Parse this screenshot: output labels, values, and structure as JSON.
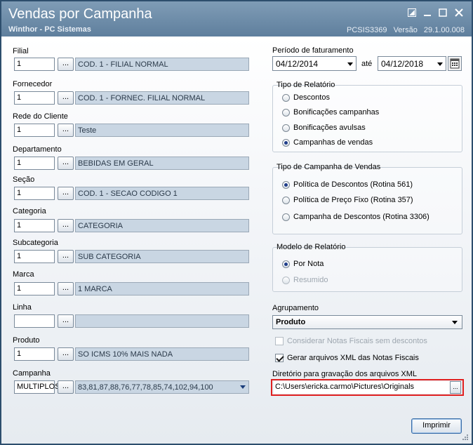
{
  "window": {
    "title": "Vendas por Campanha",
    "subtitle": "Winthor - PC Sistemas",
    "program": "PCSIS3369",
    "version_label": "Versão",
    "version": "29.1.00.008"
  },
  "fields": [
    {
      "label": "Filial",
      "code": "1",
      "desc": "COD. 1 - FILIAL NORMAL"
    },
    {
      "label": "Fornecedor",
      "code": "1",
      "desc": "COD. 1 - FORNEC. FILIAL NORMAL"
    },
    {
      "label": "Rede do Cliente",
      "code": "1",
      "desc": "Teste"
    },
    {
      "label": "Departamento",
      "code": "1",
      "desc": "BEBIDAS EM GERAL"
    },
    {
      "label": "Seção",
      "code": "1",
      "desc": "COD. 1 - SECAO CODIGO 1"
    },
    {
      "label": "Categoria",
      "code": "1",
      "desc": "CATEGORIA"
    },
    {
      "label": "Subcategoria",
      "code": "1",
      "desc": "SUB CATEGORIA"
    },
    {
      "label": "Marca",
      "code": "1",
      "desc": "1 MARCA"
    },
    {
      "label": "Linha",
      "code": "",
      "desc": ""
    },
    {
      "label": "Produto",
      "code": "1",
      "desc": "SO ICMS 10% MAIS NADA"
    },
    {
      "label": "Campanha",
      "code": "MULTIPLOS",
      "desc": "83,81,87,88,76,77,78,85,74,102,94,100"
    }
  ],
  "dots_label": "...",
  "periodo": {
    "label": "Período de faturamento",
    "start": "04/12/2014",
    "until_label": "até",
    "end": "04/12/2018"
  },
  "tipo_relatorio": {
    "title": "Tipo de Relatório",
    "options": [
      "Descontos",
      "Bonificações campanhas",
      "Bonificações avulsas",
      "Campanhas de vendas"
    ],
    "selected": 3
  },
  "tipo_campanha": {
    "title": "Tipo de Campanha de Vendas",
    "options": [
      "Política de Descontos (Rotina 561)",
      "Política de Preço Fixo (Rotina 357)",
      "Campanha de Descontos (Rotina 3306)"
    ],
    "selected": 0
  },
  "modelo": {
    "title": "Modelo de Relatório",
    "options": [
      "Por Nota",
      "Resumido"
    ],
    "selected": 0
  },
  "agrupamento": {
    "label": "Agrupamento",
    "value": "Produto"
  },
  "checks": {
    "sem_descontos": "Considerar Notas Fiscais sem descontos",
    "gerar_xml": "Gerar arquivos XML das Notas Fiscais"
  },
  "diretorio": {
    "label": "Diretório para gravação dos arquivos XML",
    "value": "C:\\Users\\ericka.carmo\\Pictures\\Originals",
    "btn": "..."
  },
  "imprimir": "Imprimir"
}
